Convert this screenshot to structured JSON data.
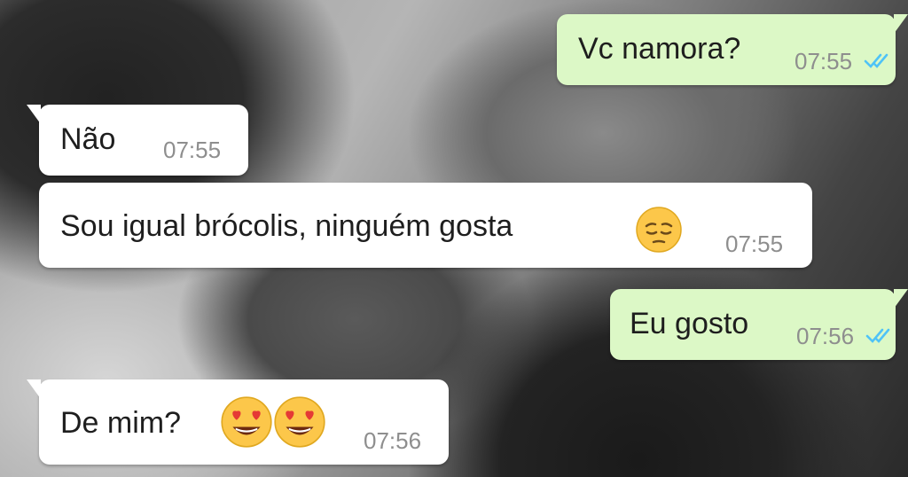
{
  "chat": {
    "messages": [
      {
        "direction": "out",
        "text": "Vc namora?",
        "time": "07:55",
        "status_icon": "double-check-read-icon",
        "status_color": "#4fc3f7"
      },
      {
        "direction": "in",
        "text": "Não",
        "time": "07:55"
      },
      {
        "direction": "in",
        "text": "Sou igual brócolis, ninguém gosta",
        "time": "07:55",
        "emoji": [
          "pensive-face-emoji"
        ]
      },
      {
        "direction": "out",
        "text": "Eu gosto",
        "time": "07:56",
        "status_icon": "double-check-read-icon",
        "status_color": "#4fc3f7"
      },
      {
        "direction": "in",
        "text": "De mim?",
        "time": "07:56",
        "emoji": [
          "heart-eyes-emoji",
          "heart-eyes-emoji"
        ]
      }
    ]
  },
  "colors": {
    "incoming_bubble": "#ffffff",
    "outgoing_bubble": "#dcf8c6",
    "timestamp": "#8e8e8e",
    "read_ticks": "#4fc3f7"
  }
}
